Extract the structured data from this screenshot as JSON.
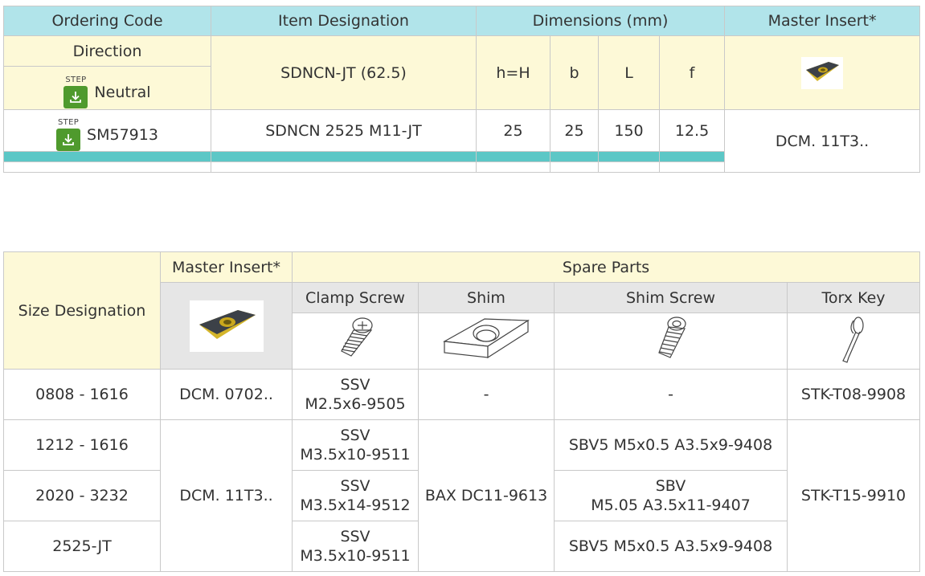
{
  "table1": {
    "headers": {
      "ordering_code": "Ordering Code",
      "item_designation": "Item Designation",
      "dimensions": "Dimensions (mm)",
      "master_insert": "Master Insert*"
    },
    "direction_label": "Direction",
    "step_label": "STEP",
    "direction_value": "Neutral",
    "series": "SDNCN-JT (62.5)",
    "dim_labels": {
      "h": "h=H",
      "b": "b",
      "L": "L",
      "f": "f"
    },
    "row": {
      "code": "SM57913",
      "designation": "SDNCN 2525 M11-JT",
      "h": "25",
      "b": "25",
      "L": "150",
      "f": "12.5",
      "insert": "DCM. 11T3.."
    }
  },
  "table2": {
    "headers": {
      "size_designation": "Size Designation",
      "master_insert": "Master Insert*",
      "spare_parts": "Spare Parts",
      "clamp_screw": "Clamp Screw",
      "shim": "Shim",
      "shim_screw": "Shim Screw",
      "torx_key": "Torx Key"
    },
    "rows": [
      {
        "size": "0808 - 1616",
        "insert": "DCM. 0702..",
        "clamp_1": "SSV",
        "clamp_2": "M2.5x6-9505",
        "shim": "-",
        "shim_screw": "-",
        "torx": "STK-T08-9908"
      },
      {
        "size": "1212 - 1616",
        "insert": "DCM. 11T3..",
        "clamp_1": "SSV",
        "clamp_2": "M3.5x10-9511",
        "shim": "BAX DC11-9613",
        "shim_screw": "SBV5 M5x0.5 A3.5x9-9408",
        "torx": "STK-T15-9910"
      },
      {
        "size": "2020 - 3232",
        "clamp_1": "SSV",
        "clamp_2": "M3.5x14-9512",
        "shim_screw_1": "SBV",
        "shim_screw_2": "M5.05 A3.5x11-9407"
      },
      {
        "size": "2525-JT",
        "clamp_1": "SSV",
        "clamp_2": "M3.5x10-9511",
        "shim_screw": "SBV5 M5x0.5 A3.5x9-9408"
      }
    ]
  },
  "colors": {
    "header": "#b1e4ea",
    "cream": "#fdf9d7",
    "gray": "#e6e6e6",
    "teal_bar": "#5cc7c6",
    "step_green": "#4f9a2d"
  },
  "icons": [
    "download-step-icon",
    "insert-icon",
    "clamp-screw-icon",
    "shim-icon",
    "shim-screw-icon",
    "torx-key-icon"
  ]
}
